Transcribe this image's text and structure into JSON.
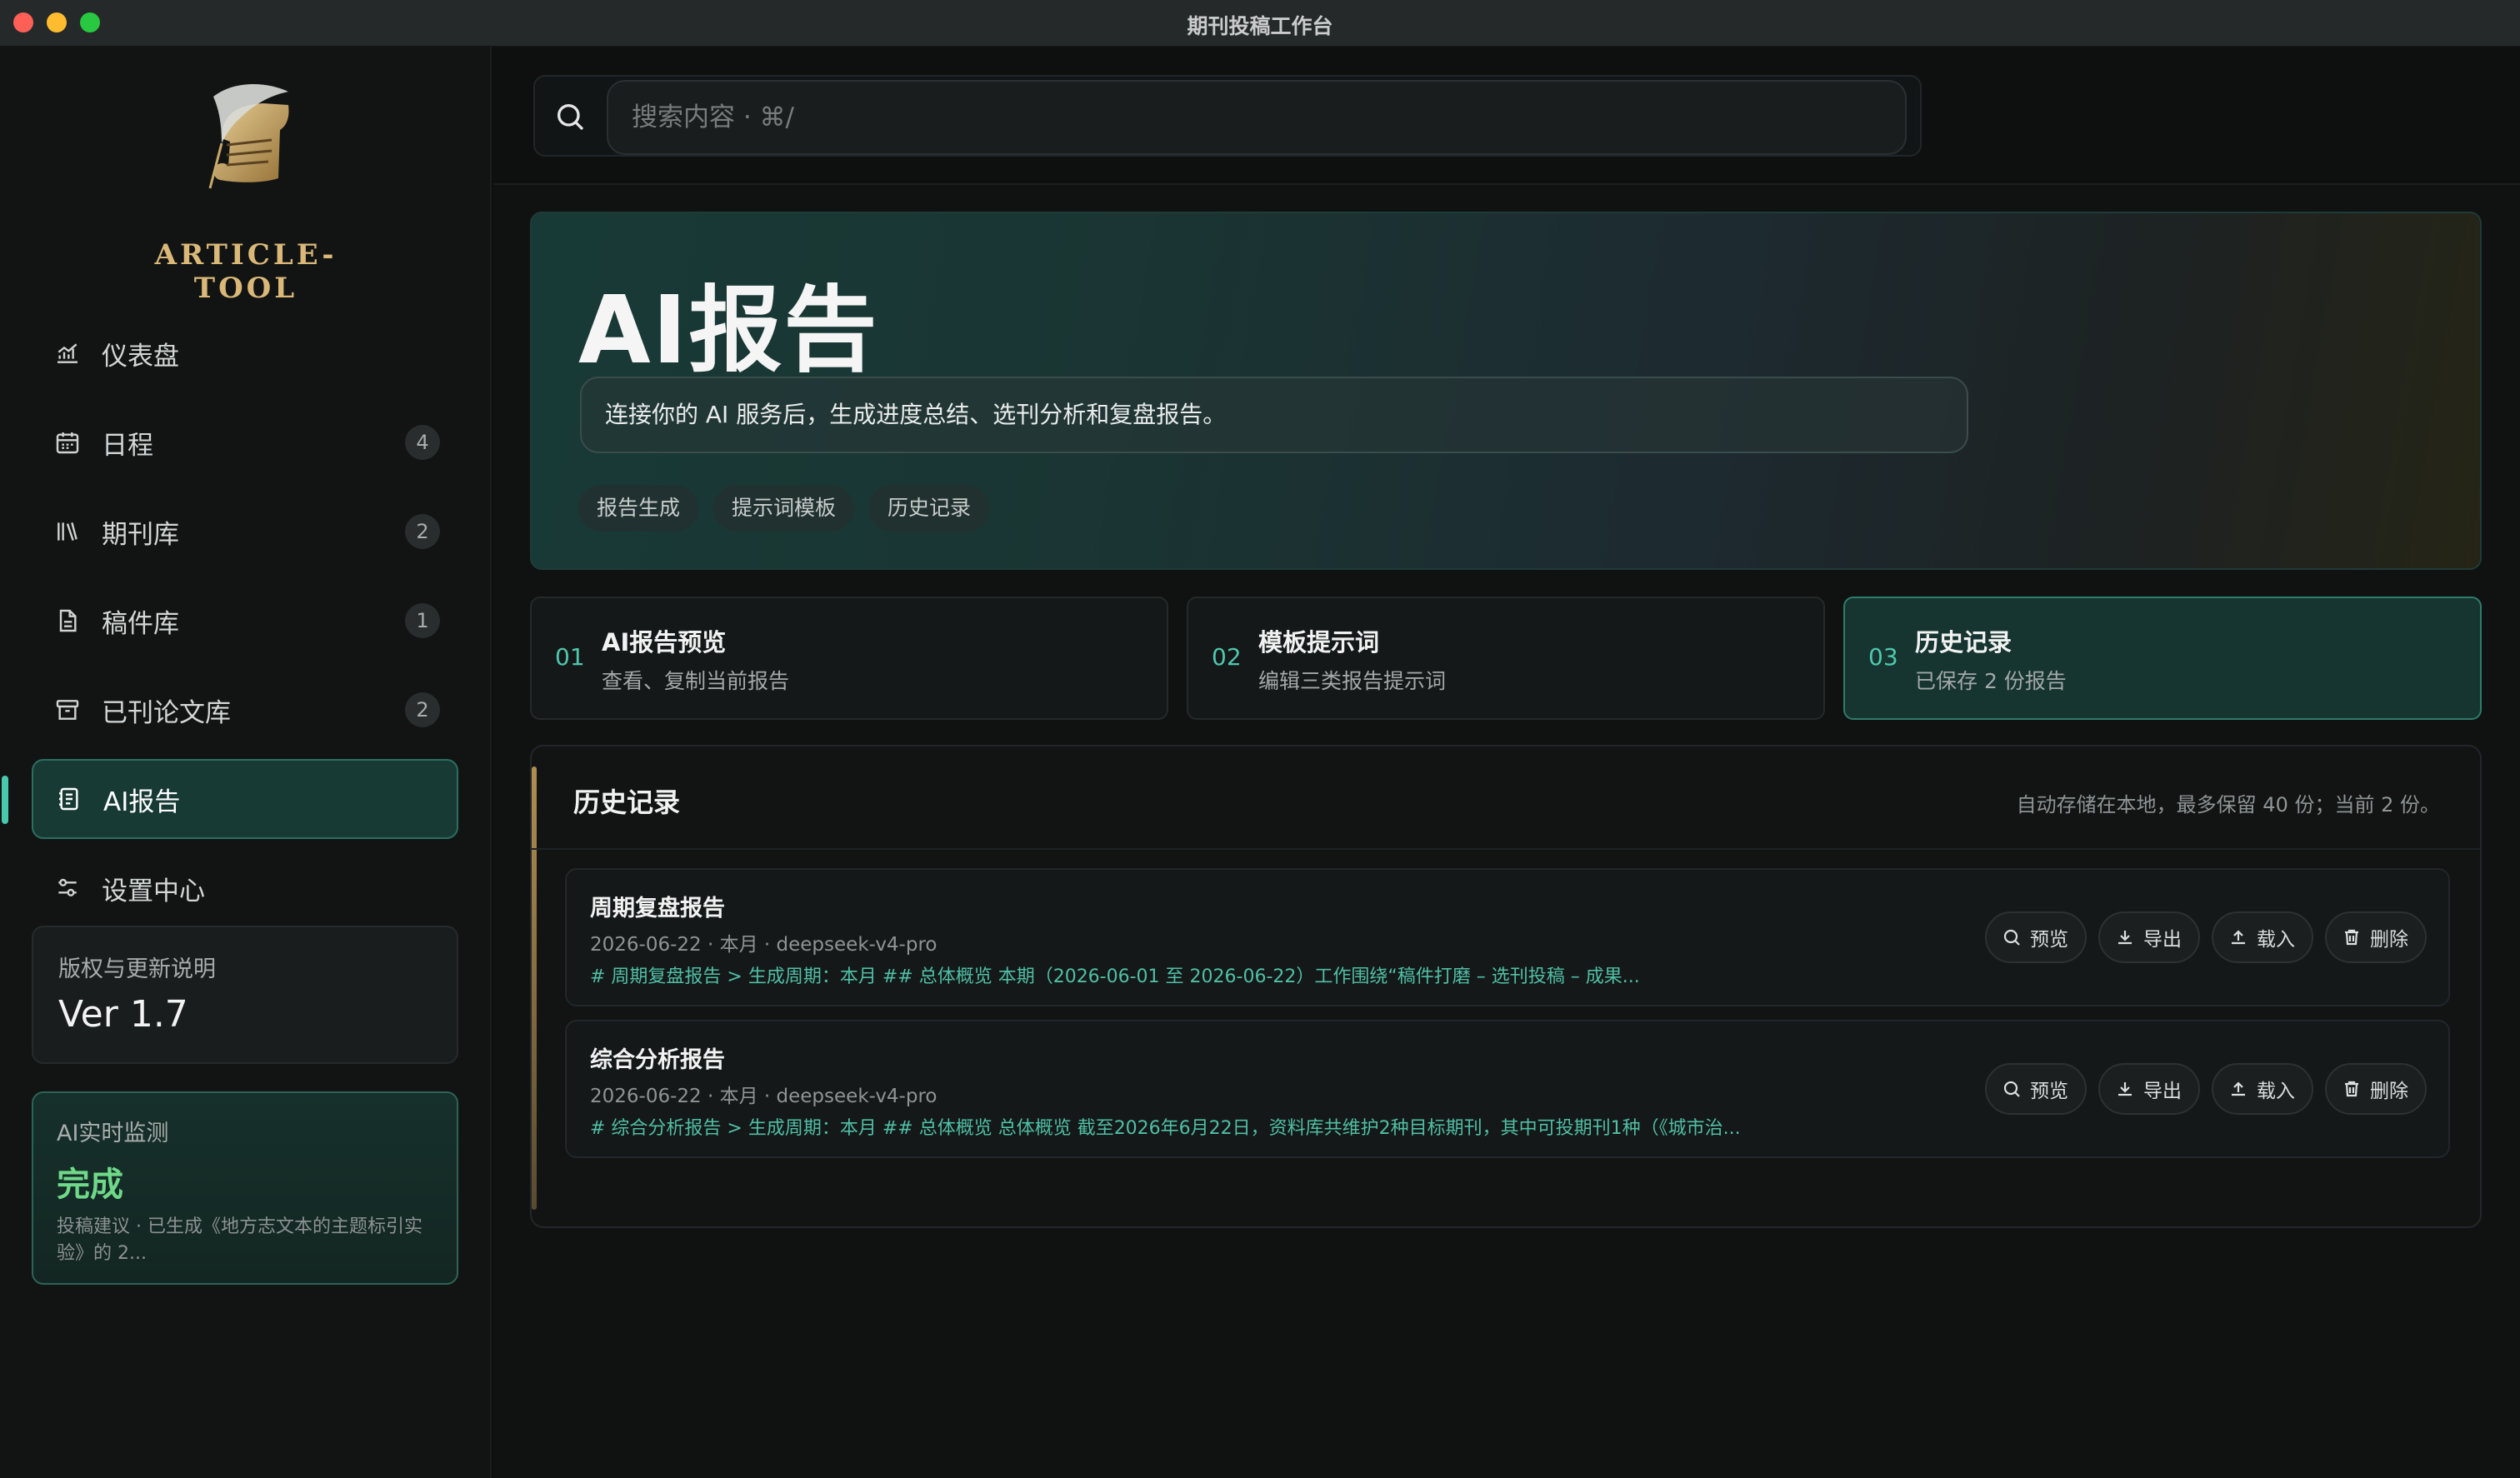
{
  "window": {
    "title": "期刊投稿工作台"
  },
  "sidebar": {
    "logo_text": "ARTICLE-TOOL",
    "items": [
      {
        "label": "仪表盘",
        "icon": "chart-icon",
        "count": ""
      },
      {
        "label": "日程",
        "icon": "calendar-icon",
        "count": "4"
      },
      {
        "label": "期刊库",
        "icon": "library-icon",
        "count": "2"
      },
      {
        "label": "稿件库",
        "icon": "document-icon",
        "count": "1"
      },
      {
        "label": "已刊论文库",
        "icon": "archive-icon",
        "count": "2"
      },
      {
        "label": "AI报告",
        "icon": "report-icon",
        "count": "",
        "active": true
      },
      {
        "label": "设置中心",
        "icon": "settings-sliders-icon",
        "count": ""
      }
    ],
    "version_card": {
      "label": "版权与更新说明",
      "value": "Ver 1.7"
    },
    "monitor_card": {
      "label": "AI实时监测",
      "status": "完成",
      "detail": "投稿建议 · 已生成《地方志文本的主题标引实验》的 2..."
    }
  },
  "search": {
    "placeholder": "搜索内容 · ⌘/"
  },
  "hero": {
    "title": "AI报告",
    "description": "连接你的 AI 服务后，生成进度总结、选刊分析和复盘报告。",
    "chips": [
      "报告生成",
      "提示词模板",
      "历史记录"
    ]
  },
  "steps": [
    {
      "num": "01",
      "title": "AI报告预览",
      "sub": "查看、复制当前报告"
    },
    {
      "num": "02",
      "title": "模板提示词",
      "sub": "编辑三类报告提示词"
    },
    {
      "num": "03",
      "title": "历史记录",
      "sub": "已保存 2 份报告",
      "active": true
    }
  ],
  "history": {
    "title": "历史记录",
    "note": "自动存储在本地，最多保留 40 份；当前 2 份。",
    "records": [
      {
        "title": "周期复盘报告",
        "meta": "2026-06-22 · 本月 · deepseek-v4-pro",
        "preview": "# 周期复盘报告 > 生成周期：本月 ## 总体概览 本期（2026-06-01 至 2026-06-22）工作围绕“稿件打磨 – 选刊投稿 – 成果..."
      },
      {
        "title": "综合分析报告",
        "meta": "2026-06-22 · 本月 · deepseek-v4-pro",
        "preview": "# 综合分析报告 > 生成周期：本月 ## 总体概览 总体概览 截至2026年6月22日，资料库共维护2种目标期刊，其中可投期刊1种（《城市治..."
      }
    ],
    "actions": {
      "preview": "预览",
      "export": "导出",
      "load": "载入",
      "delete": "删除"
    }
  },
  "colors": {
    "accent": "#48c9ad",
    "success": "#6fd889",
    "gold": "#d9b878"
  }
}
